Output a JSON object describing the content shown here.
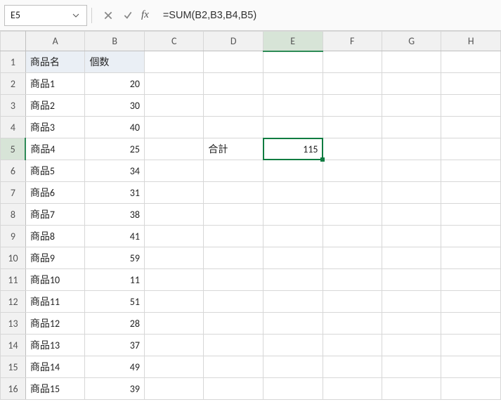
{
  "name_box": {
    "value": "E5"
  },
  "formula_bar": {
    "formula": "=SUM(B2,B3,B4,B5)"
  },
  "columns": [
    "A",
    "B",
    "C",
    "D",
    "E",
    "F",
    "G",
    "H"
  ],
  "selected_cell": {
    "ref": "E5",
    "col": "E",
    "row": 5
  },
  "headers": {
    "col_a": "商品名",
    "col_b": "個数"
  },
  "label_total": "合計",
  "rows": [
    {
      "num": 1,
      "a": "商品名",
      "b": "個数",
      "c": "",
      "d": "",
      "e": "",
      "header_row": true
    },
    {
      "num": 2,
      "a": "商品1",
      "b": 20,
      "c": "",
      "d": "",
      "e": ""
    },
    {
      "num": 3,
      "a": "商品2",
      "b": 30,
      "c": "",
      "d": "",
      "e": ""
    },
    {
      "num": 4,
      "a": "商品3",
      "b": 40,
      "c": "",
      "d": "",
      "e": ""
    },
    {
      "num": 5,
      "a": "商品4",
      "b": 25,
      "c": "",
      "d": "合計",
      "e": 115,
      "selected": true
    },
    {
      "num": 6,
      "a": "商品5",
      "b": 34,
      "c": "",
      "d": "",
      "e": ""
    },
    {
      "num": 7,
      "a": "商品6",
      "b": 31,
      "c": "",
      "d": "",
      "e": ""
    },
    {
      "num": 8,
      "a": "商品7",
      "b": 38,
      "c": "",
      "d": "",
      "e": ""
    },
    {
      "num": 9,
      "a": "商品8",
      "b": 41,
      "c": "",
      "d": "",
      "e": ""
    },
    {
      "num": 10,
      "a": "商品9",
      "b": 59,
      "c": "",
      "d": "",
      "e": ""
    },
    {
      "num": 11,
      "a": "商品10",
      "b": 11,
      "c": "",
      "d": "",
      "e": ""
    },
    {
      "num": 12,
      "a": "商品11",
      "b": 51,
      "c": "",
      "d": "",
      "e": ""
    },
    {
      "num": 13,
      "a": "商品12",
      "b": 28,
      "c": "",
      "d": "",
      "e": ""
    },
    {
      "num": 14,
      "a": "商品13",
      "b": 37,
      "c": "",
      "d": "",
      "e": ""
    },
    {
      "num": 15,
      "a": "商品14",
      "b": 49,
      "c": "",
      "d": "",
      "e": ""
    },
    {
      "num": 16,
      "a": "商品15",
      "b": 39,
      "c": "",
      "d": "",
      "e": ""
    }
  ]
}
